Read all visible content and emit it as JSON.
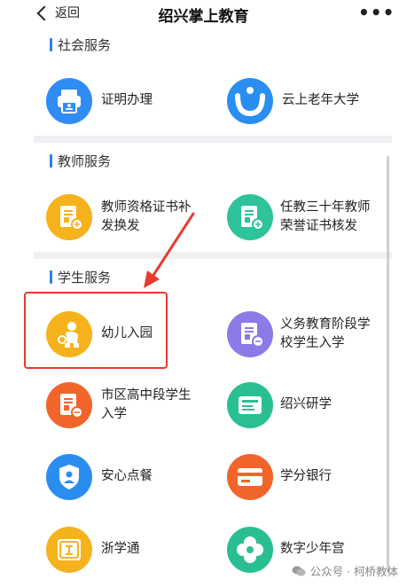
{
  "nav": {
    "back_label": "返回",
    "title": "绍兴掌上教育",
    "more_label": "•••"
  },
  "sections": {
    "social": {
      "title": "社会服务",
      "items": [
        {
          "label": "证明办理",
          "icon": "printer-icon",
          "color": "#2f8cf5"
        },
        {
          "label": "云上老年大学",
          "icon": "smile-icon",
          "color": "#2a8ef0"
        }
      ]
    },
    "teacher": {
      "title": "教师服务",
      "items": [
        {
          "label": "教师资格证书补发换发",
          "icon": "certificate-icon",
          "color": "#f5b21c"
        },
        {
          "label": "任教三十年教师荣誉证书核发",
          "icon": "certificate-icon",
          "color": "#2ec39a"
        }
      ]
    },
    "student": {
      "title": "学生服务",
      "items": [
        {
          "label": "幼儿入园",
          "icon": "child-icon",
          "color": "#f6b21a"
        },
        {
          "label": "义务教育阶段学校学生入学",
          "icon": "certificate-icon",
          "color": "#8c7ae6"
        },
        {
          "label": "市区高中段学生入学",
          "icon": "certificate-icon",
          "color": "#f2652a"
        },
        {
          "label": "绍兴研学",
          "icon": "id-card-icon",
          "color": "#29bf93"
        },
        {
          "label": "安心点餐",
          "icon": "shield-icon",
          "color": "#2a8ef0"
        },
        {
          "label": "学分银行",
          "icon": "card-icon",
          "color": "#f2652a"
        },
        {
          "label": "浙学通",
          "icon": "book-icon",
          "color": "#f5b21c"
        },
        {
          "label": "数字少年宫",
          "icon": "flower-icon",
          "color": "#29bf93"
        }
      ]
    }
  },
  "watermark": {
    "text": "公众号 · 柯桥教体"
  },
  "colors": {
    "accent": "#2f7df6",
    "highlight": "#e63b2e",
    "divider": "#eef0f3"
  }
}
